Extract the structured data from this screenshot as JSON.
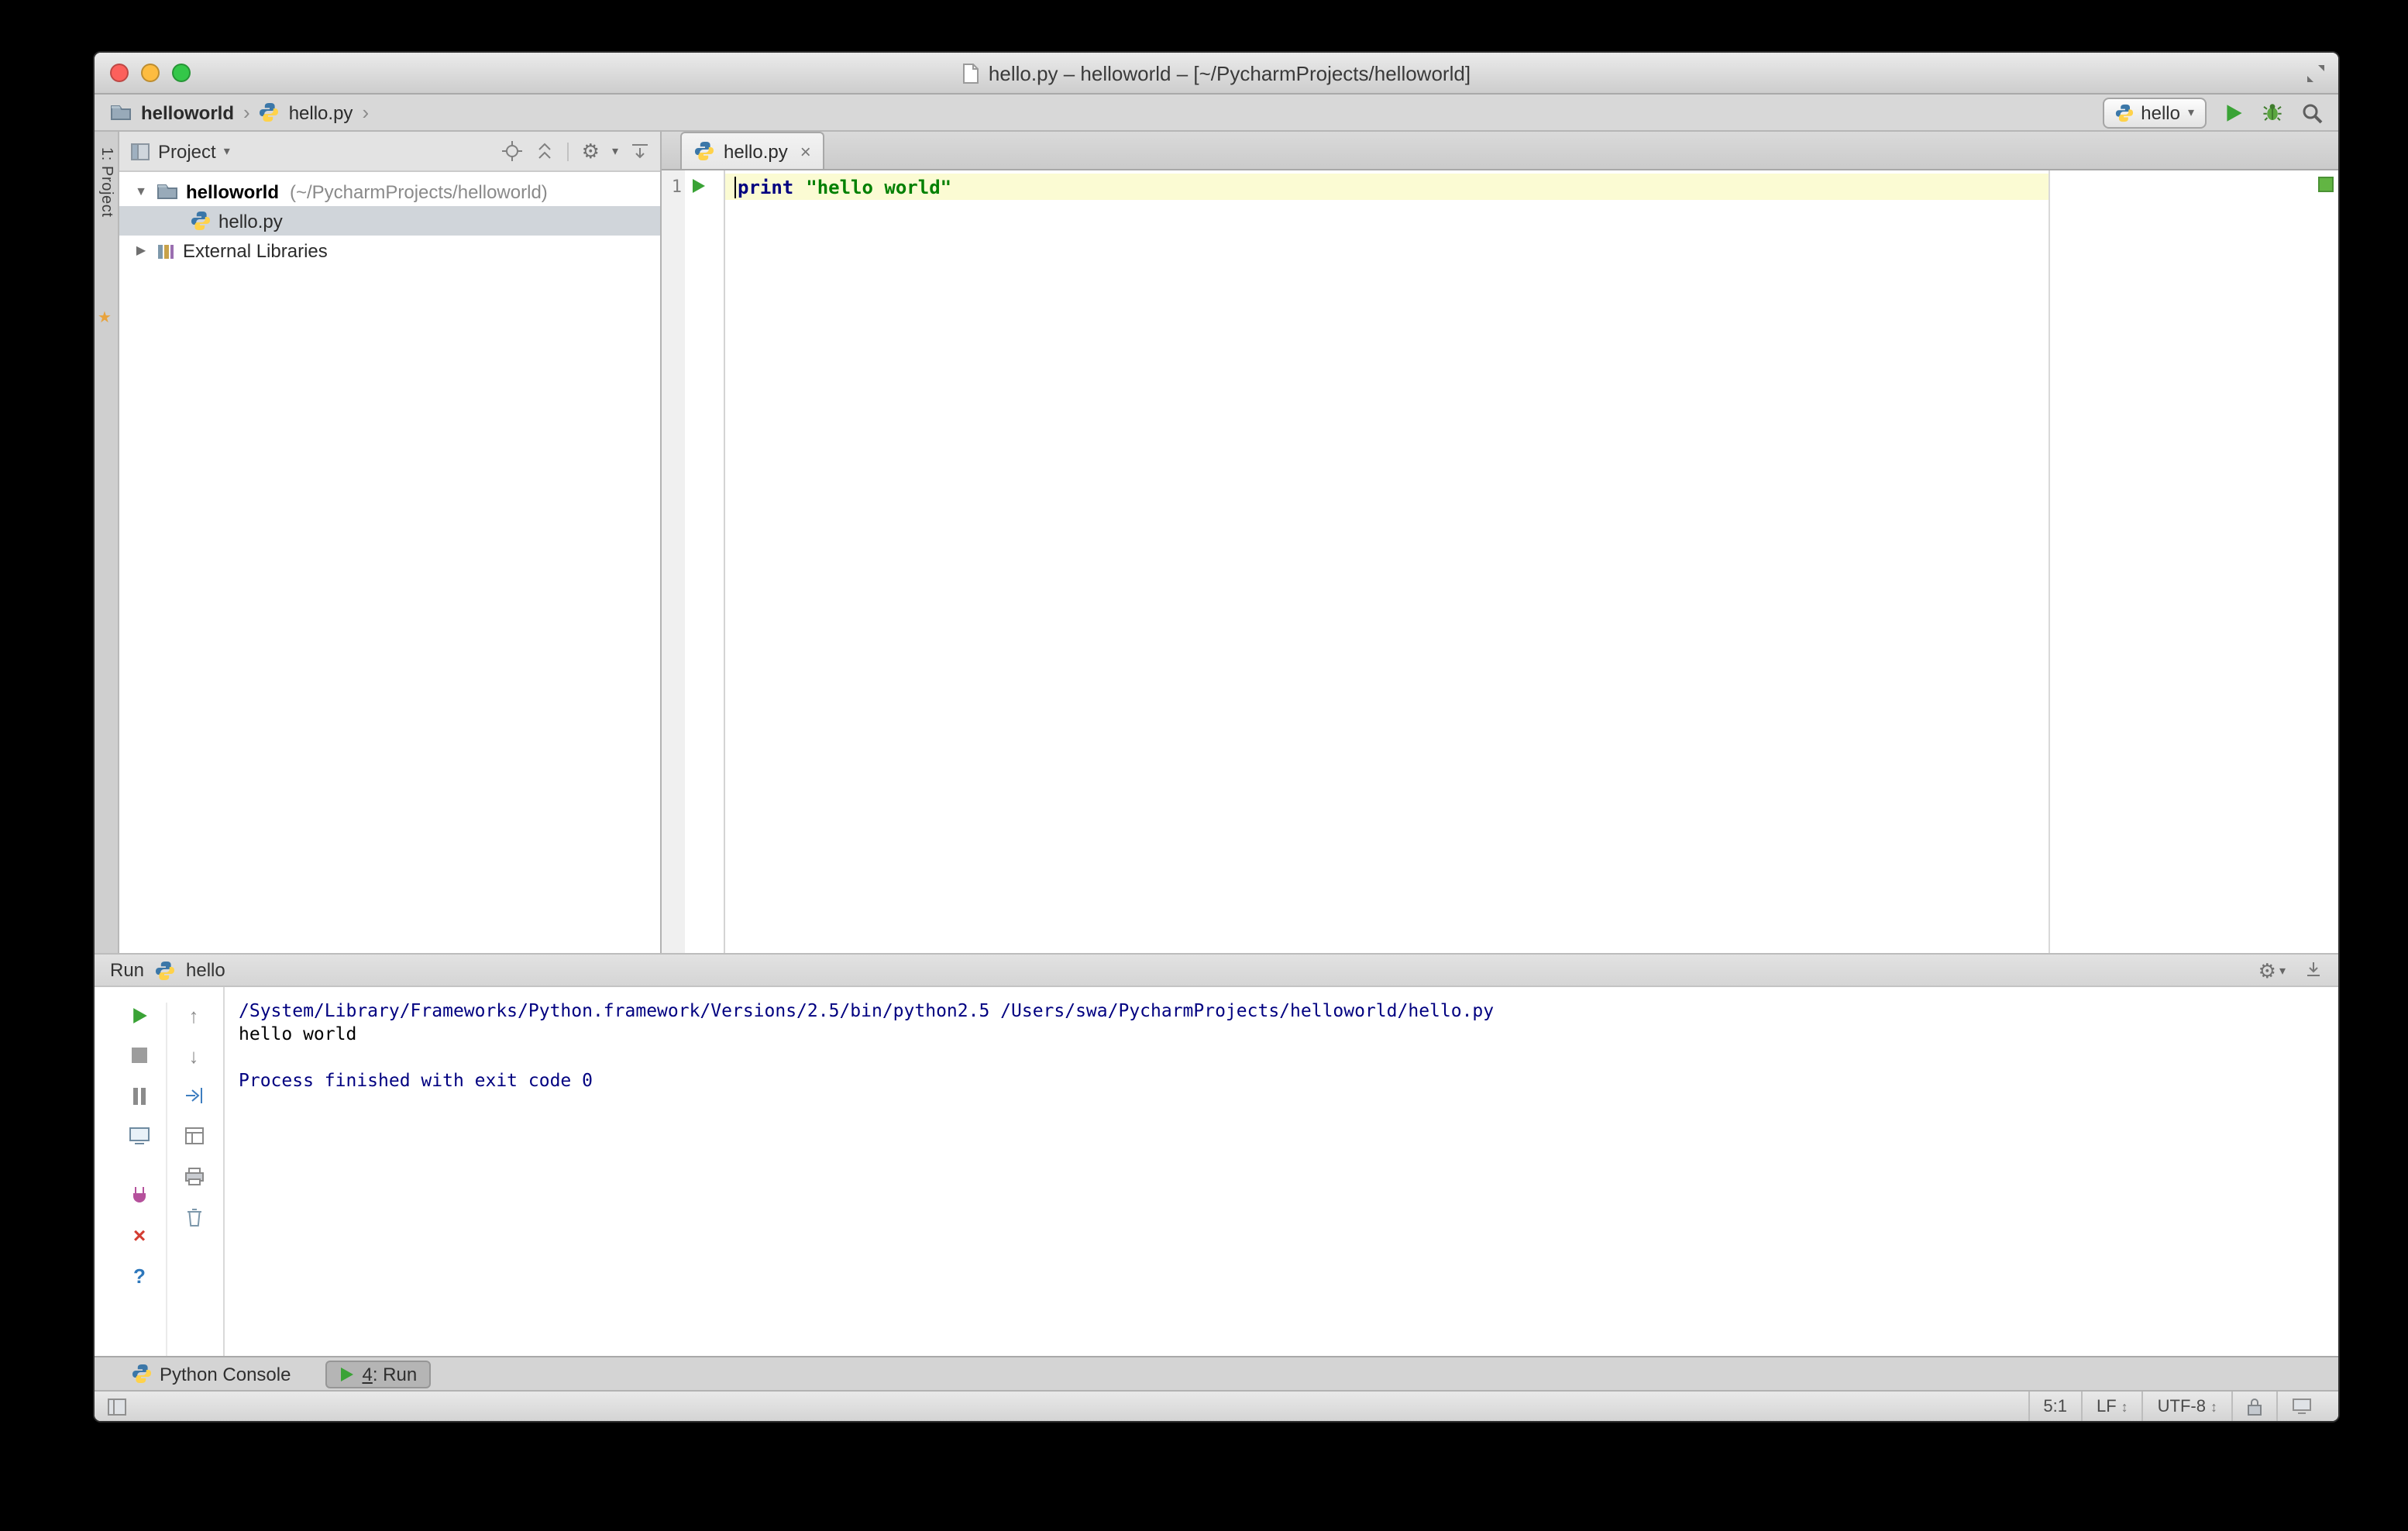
{
  "window": {
    "title": "hello.py – helloworld – [~/PycharmProjects/helloworld]"
  },
  "breadcrumbs": {
    "project": "helloworld",
    "file": "hello.py"
  },
  "run_toolbar": {
    "config_name": "hello"
  },
  "tool_stripe": {
    "project_label": "1: Project"
  },
  "project_panel": {
    "title": "Project",
    "tree": {
      "root_name": "helloworld",
      "root_path": "(~/PycharmProjects/helloworld)",
      "file": "hello.py",
      "external": "External Libraries"
    }
  },
  "editor": {
    "tab_label": "hello.py",
    "line1_number": "1",
    "keyword": "print",
    "string": "\"hello world\""
  },
  "run_panel": {
    "title": "Run",
    "config_name": "hello",
    "console_line1": "/System/Library/Frameworks/Python.framework/Versions/2.5/bin/python2.5 /Users/swa/PycharmProjects/helloworld/hello.py",
    "console_line2": "hello world",
    "console_line4": "Process finished with exit code 0"
  },
  "bottom_bar": {
    "python_console": "Python Console",
    "run_num": "4",
    "run_rest": ": Run"
  },
  "status_bar": {
    "caret_pos": "5:1",
    "line_sep": "LF",
    "encoding": "UTF-8"
  },
  "glyphs": {
    "chevron": "›",
    "caret_down": "▾",
    "tri_open": "▼",
    "tri_closed": "▶",
    "up": "↑",
    "down": "↓",
    "close": "×",
    "help": "?",
    "gear": "⚙",
    "updown": "↕",
    "favorites": "★"
  },
  "colors": {
    "keyword_color": "#000080",
    "string_color": "#008000",
    "console_info_color": "#000080",
    "run_green": "#3aa336",
    "selection_bg": "#d0d5da",
    "caret_line_bg": "#fbfbd3"
  }
}
